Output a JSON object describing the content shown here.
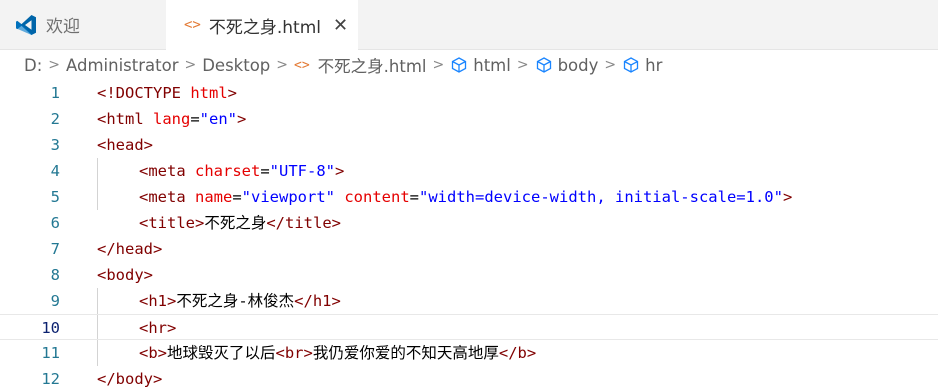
{
  "tabs": [
    {
      "label": "欢迎",
      "icon": "vscode-icon"
    },
    {
      "label": "不死之身.html",
      "icon": "html-file-icon",
      "active": true
    }
  ],
  "breadcrumb": [
    "D:",
    "Administrator",
    "Desktop",
    "不死之身.html",
    "html",
    "body",
    "hr"
  ],
  "editor": {
    "current_line": 10,
    "lines": [
      {
        "n": "1",
        "tokens": [
          [
            "d",
            "<!DOCTYPE "
          ],
          [
            "a",
            "html"
          ],
          [
            "d",
            ">"
          ]
        ]
      },
      {
        "n": "2",
        "tokens": [
          [
            "t",
            "<html "
          ],
          [
            "a",
            "lang"
          ],
          [
            "x",
            "="
          ],
          [
            "v",
            "\"en\""
          ],
          [
            "t",
            ">"
          ]
        ]
      },
      {
        "n": "3",
        "tokens": [
          [
            "t",
            "<head>"
          ]
        ]
      },
      {
        "n": "4",
        "indent": 1,
        "tokens": [
          [
            "t",
            "<meta "
          ],
          [
            "a",
            "charset"
          ],
          [
            "x",
            "="
          ],
          [
            "v",
            "\"UTF-8\""
          ],
          [
            "t",
            ">"
          ]
        ]
      },
      {
        "n": "5",
        "indent": 1,
        "tokens": [
          [
            "t",
            "<meta "
          ],
          [
            "a",
            "name"
          ],
          [
            "x",
            "="
          ],
          [
            "v",
            "\"viewport\""
          ],
          [
            "x",
            " "
          ],
          [
            "a",
            "content"
          ],
          [
            "x",
            "="
          ],
          [
            "v",
            "\"width=device-width, initial-scale=1.0\""
          ],
          [
            "t",
            ">"
          ]
        ]
      },
      {
        "n": "6",
        "indent": 1,
        "tokens": [
          [
            "t",
            "<title>"
          ],
          [
            "x",
            "不死之身"
          ],
          [
            "t",
            "</title>"
          ]
        ]
      },
      {
        "n": "7",
        "tokens": [
          [
            "t",
            "</head>"
          ]
        ]
      },
      {
        "n": "8",
        "tokens": [
          [
            "t",
            "<body>"
          ]
        ]
      },
      {
        "n": "9",
        "indent": 1,
        "tokens": [
          [
            "t",
            "<h1>"
          ],
          [
            "x",
            "不死之身-林俊杰"
          ],
          [
            "t",
            "</h1>"
          ]
        ]
      },
      {
        "n": "10",
        "indent": 1,
        "tokens": [
          [
            "t",
            "<hr>"
          ]
        ]
      },
      {
        "n": "11",
        "indent": 1,
        "tokens": [
          [
            "t",
            "<b>"
          ],
          [
            "x",
            "地球毁灭了以后"
          ],
          [
            "t",
            "<br>"
          ],
          [
            "x",
            "我仍爱你爱的不知天高地厚"
          ],
          [
            "t",
            "</b>"
          ]
        ]
      },
      {
        "n": "12",
        "tokens": [
          [
            "t",
            "</body>"
          ]
        ]
      }
    ]
  },
  "colors": {
    "tag": "#800000",
    "attribute": "#e50000",
    "string": "#0000ff",
    "line_number": "#237893",
    "html_icon": "#e37933",
    "vscode_blue": "#0065a9"
  }
}
